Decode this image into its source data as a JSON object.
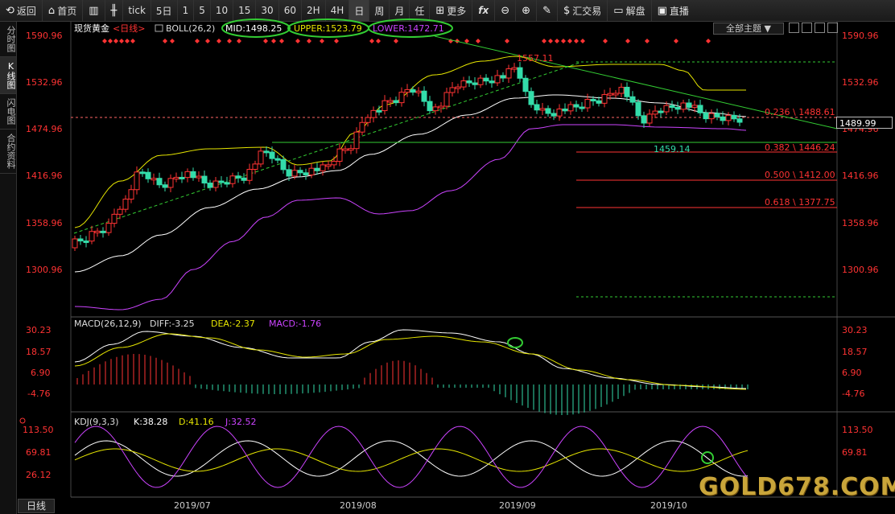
{
  "toolbar": {
    "back": "返回",
    "home": "首页",
    "periods": [
      "tick",
      "5日",
      "1",
      "5",
      "10",
      "15",
      "30",
      "60",
      "2H",
      "4H",
      "日",
      "周",
      "月",
      "任"
    ],
    "more": "更多",
    "fx": "fx",
    "trade": "汇交易",
    "unlock": "解盘",
    "live": "直播"
  },
  "sidebar": {
    "tabs": [
      "分时图",
      "K线图",
      "闪电图",
      "合约资料"
    ]
  },
  "chart": {
    "instrument": "现货黄金",
    "interval": "<日线>",
    "boll_label": "BOLL(26,2)",
    "mid": "MID:1498.25",
    "upper": "UPPER:1523.79",
    "lower": "LOWER:1472.71",
    "theme": "全部主题",
    "price_axis": [
      "1590.96",
      "1532.96",
      "1474.96",
      "1416.96",
      "1358.96",
      "1300.96"
    ],
    "current_price": "1489.99",
    "high_label": "1557.11",
    "low_label": "1459.14",
    "fib_labels": [
      "0.236 \\ 1488.61",
      "0.382 \\ 1446.24",
      "0.500 \\ 1412.00",
      "0.618 \\ 1377.75"
    ],
    "macd_label": "MACD(26,12,9)",
    "diff": "DIFF:-3.25",
    "dea": "DEA:-2.37",
    "macd_val": "MACD:-1.76",
    "macd_axis": [
      "30.23",
      "18.57",
      "6.90",
      "-4.76"
    ],
    "kdj_label": "KDJ(9,3,3)",
    "k": "K:38.28",
    "d": "D:41.16",
    "j": "J:32.52",
    "kdj_axis": [
      "113.50",
      "69.81",
      "26.12"
    ],
    "dates": [
      "2019/07",
      "2019/08",
      "2019/09",
      "2019/10"
    ],
    "bottom_tab": "日线",
    "watermark": "GOLD678.COM",
    "watermark_small": "26.12"
  },
  "colors": {
    "up": "#ff3333",
    "down": "#33ddaa",
    "boll_mid": "#ffffff",
    "boll_upper": "#e6e600",
    "boll_lower": "#cc44ff",
    "trend": "#33cc33",
    "axis_text": "#ff3333"
  }
}
